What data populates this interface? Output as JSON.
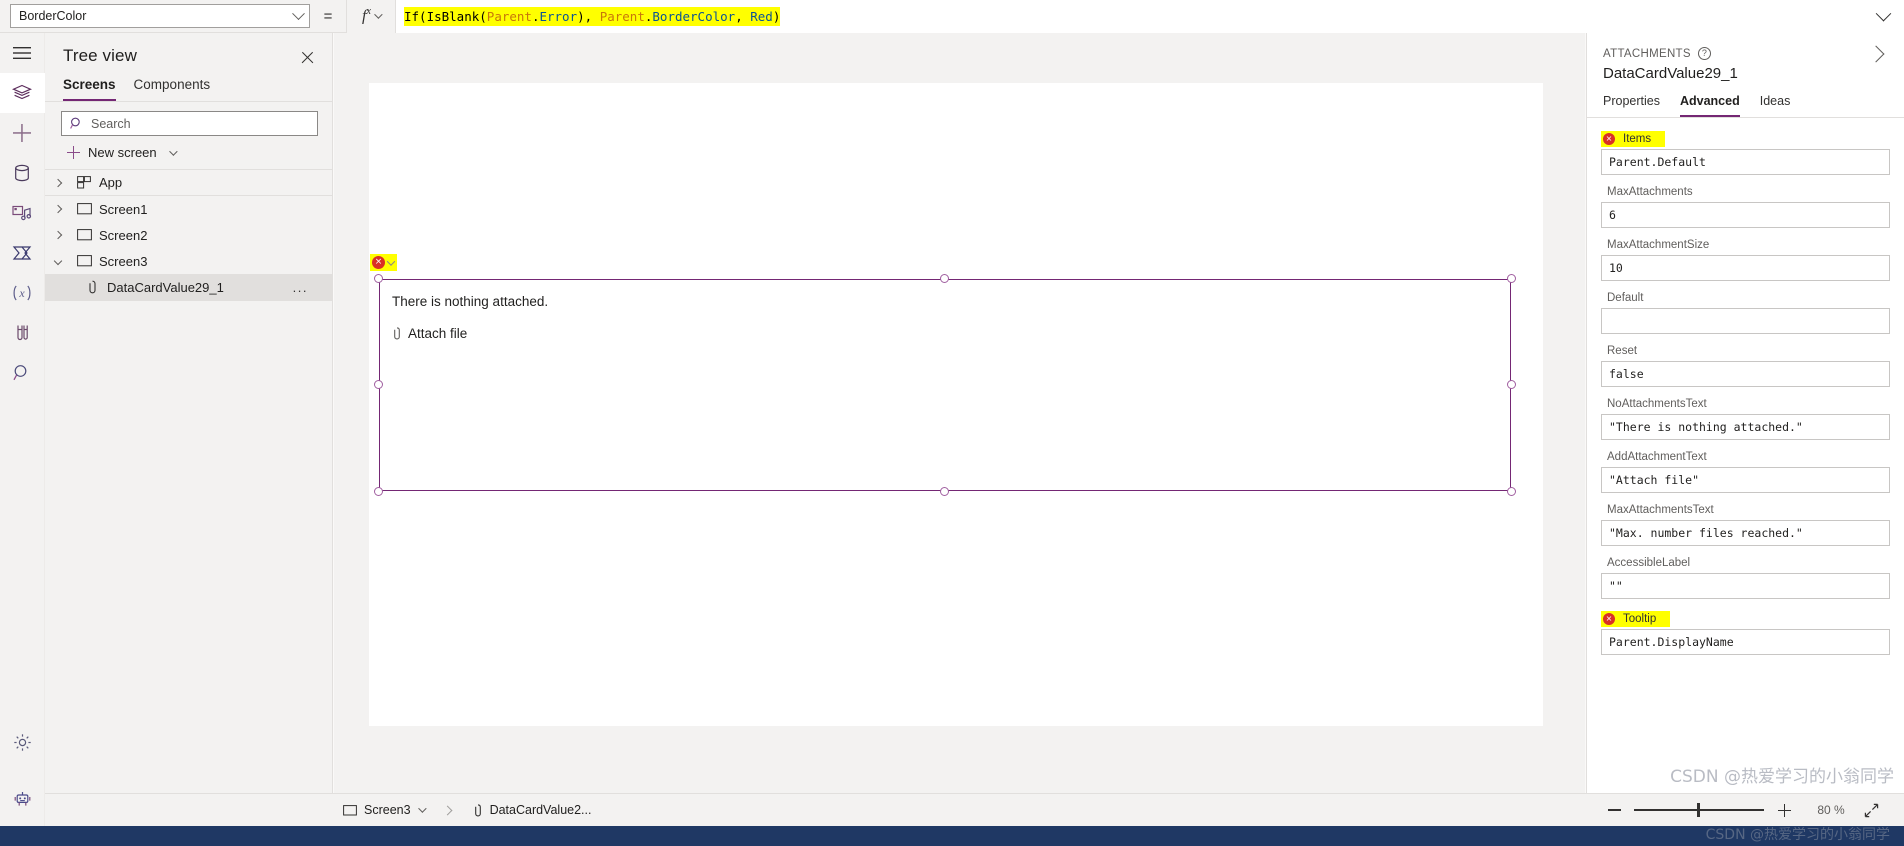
{
  "formula_bar": {
    "property_selected": "BorderColor",
    "equals": "=",
    "fx_label": "fx",
    "formula_tokens": [
      {
        "t": "If(IsBlank(",
        "c": "fn"
      },
      {
        "t": "Parent",
        "c": "obj"
      },
      {
        "t": ".",
        "c": "punct"
      },
      {
        "t": "Error",
        "c": "prop"
      },
      {
        "t": "), ",
        "c": "punct"
      },
      {
        "t": "Parent",
        "c": "obj"
      },
      {
        "t": ".",
        "c": "punct"
      },
      {
        "t": "BorderColor",
        "c": "prop"
      },
      {
        "t": ", ",
        "c": "punct"
      },
      {
        "t": "Red",
        "c": "prop"
      },
      {
        "t": ")",
        "c": "punct"
      }
    ],
    "formula_plain": "If(IsBlank(Parent.Error), Parent.BorderColor, Red)",
    "highlight_color": "#ffff00"
  },
  "rail": {
    "items": [
      {
        "name": "hamburger-menu-icon",
        "label": "Menu"
      },
      {
        "name": "tree-view-icon",
        "label": "Tree view",
        "active": true
      },
      {
        "name": "insert-icon",
        "label": "Insert"
      },
      {
        "name": "data-icon",
        "label": "Data"
      },
      {
        "name": "media-icon",
        "label": "Media"
      },
      {
        "name": "power-automate-icon",
        "label": "Power Automate"
      },
      {
        "name": "variables-icon",
        "label": "Variables"
      },
      {
        "name": "test-icon",
        "label": "Tests"
      },
      {
        "name": "search-icon",
        "label": "Search"
      }
    ],
    "bottom_items": [
      {
        "name": "settings-gear-icon",
        "label": "Settings"
      },
      {
        "name": "copilot-bot-icon",
        "label": "Copilot"
      }
    ]
  },
  "tree_view": {
    "title": "Tree view",
    "tabs": [
      {
        "label": "Screens",
        "active": true
      },
      {
        "label": "Components",
        "active": false
      }
    ],
    "search_placeholder": "Search",
    "new_screen_label": "New screen",
    "nodes": [
      {
        "label": "App",
        "icon": "app-icon",
        "expanded": false,
        "indent": 0,
        "selected": false
      },
      {
        "label": "Screen1",
        "icon": "screen-icon",
        "expanded": false,
        "indent": 0,
        "selected": false
      },
      {
        "label": "Screen2",
        "icon": "screen-icon",
        "expanded": false,
        "indent": 0,
        "selected": false
      },
      {
        "label": "Screen3",
        "icon": "screen-icon",
        "expanded": true,
        "indent": 0,
        "selected": false
      },
      {
        "label": "DataCardValue29_1",
        "icon": "attachment-icon",
        "expanded": null,
        "indent": 1,
        "selected": true,
        "overflow": "..."
      }
    ]
  },
  "canvas": {
    "control": {
      "no_attachments_text": "There is nothing attached.",
      "add_attachment_text": "Attach file",
      "error_badge": "×",
      "border_color": "#742774"
    }
  },
  "properties_panel": {
    "kicker": "ATTACHMENTS",
    "help_glyph": "?",
    "control_name": "DataCardValue29_1",
    "tabs": [
      {
        "label": "Properties",
        "active": false
      },
      {
        "label": "Advanced",
        "active": true
      },
      {
        "label": "Ideas",
        "active": false
      }
    ],
    "fields": [
      {
        "label": "Items",
        "value": "Parent.Default",
        "error": true
      },
      {
        "label": "MaxAttachments",
        "value": "6",
        "error": false
      },
      {
        "label": "MaxAttachmentSize",
        "value": "10",
        "error": false
      },
      {
        "label": "Default",
        "value": "",
        "error": false
      },
      {
        "label": "Reset",
        "value": "false",
        "error": false
      },
      {
        "label": "NoAttachmentsText",
        "value": "\"There is nothing attached.\"",
        "error": false
      },
      {
        "label": "AddAttachmentText",
        "value": "\"Attach file\"",
        "error": false
      },
      {
        "label": "MaxAttachmentsText",
        "value": "\"Max. number files reached.\"",
        "error": false
      },
      {
        "label": "AccessibleLabel",
        "value": "\"\"",
        "error": false
      },
      {
        "label": "Tooltip",
        "value": "Parent.DisplayName",
        "error": true
      }
    ]
  },
  "status_bar": {
    "breadcrumb": [
      {
        "label": "Screen3",
        "icon": "screen-icon",
        "has_chevron": true
      },
      {
        "label": "DataCardValue2...",
        "icon": "attachment-icon",
        "has_chevron": false
      }
    ],
    "zoom_out_label": "−",
    "zoom_in_label": "+",
    "zoom_value": "80 %",
    "fit_label": "Fit to screen"
  },
  "watermark": {
    "text": "CSDN @热爱学习的小翁同学"
  }
}
